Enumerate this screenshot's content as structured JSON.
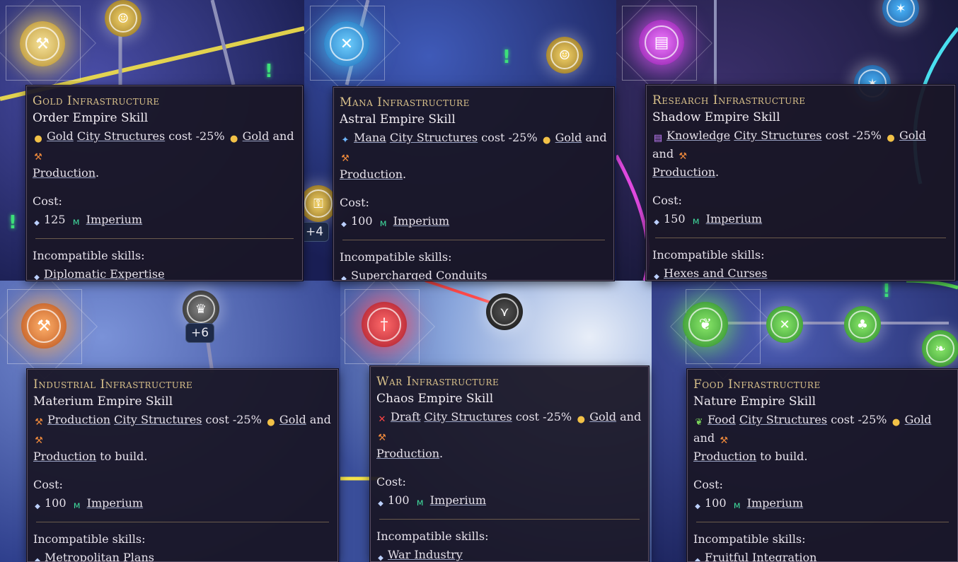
{
  "colors": {
    "title": "#d8c08a",
    "gold": "#f2c147",
    "production": "#f08a3c",
    "mana": "#6fb6ff",
    "knowledge": "#c580ff",
    "draft": "#ff4545",
    "food": "#7ad35a",
    "imperium": "#3fd79b"
  },
  "labels": {
    "city_structures": "City Structures",
    "cost_reduction": "cost -25%",
    "gold": "Gold",
    "and": "and",
    "production": "Production",
    "cost": "Cost:",
    "imperium": "Imperium",
    "incompatible": "Incompatible skills:",
    "period": ".",
    "to_build": "to build."
  },
  "badges": {
    "top_middle": "+4",
    "bottom_left": "+6"
  },
  "tooltips": [
    {
      "title": "Gold Infrastructure",
      "subtitle": "Order Empire Skill",
      "resource": "Gold",
      "resource_icon": "gold-icon",
      "ending": ".",
      "cost": "125",
      "incompatible": "Diplomatic Expertise"
    },
    {
      "title": "Mana Infrastructure",
      "subtitle": "Astral Empire Skill",
      "resource": "Mana",
      "resource_icon": "mana-icon",
      "ending": ".",
      "cost": "100",
      "incompatible": "Supercharged Conduits"
    },
    {
      "title": "Research Infrastructure",
      "subtitle": "Shadow Empire Skill",
      "resource": "Knowledge",
      "resource_icon": "knowledge-icon",
      "ending": ".",
      "cost": "150",
      "incompatible": "Hexes and Curses"
    },
    {
      "title": "Industrial Infrastructure",
      "subtitle": "Materium Empire Skill",
      "resource": "Production",
      "resource_icon": "production-icon",
      "ending": "to build.",
      "cost": "100",
      "incompatible": "Metropolitan Plans"
    },
    {
      "title": "War Infrastructure",
      "subtitle": "Chaos Empire Skill",
      "resource": "Draft",
      "resource_icon": "draft-icon",
      "ending": ".",
      "cost": "100",
      "incompatible": "War Industry"
    },
    {
      "title": "Food Infrastructure",
      "subtitle": "Nature Empire Skill",
      "resource": "Food",
      "resource_icon": "food-icon",
      "ending": "to build.",
      "cost": "100",
      "incompatible": "Fruitful Integration"
    }
  ]
}
